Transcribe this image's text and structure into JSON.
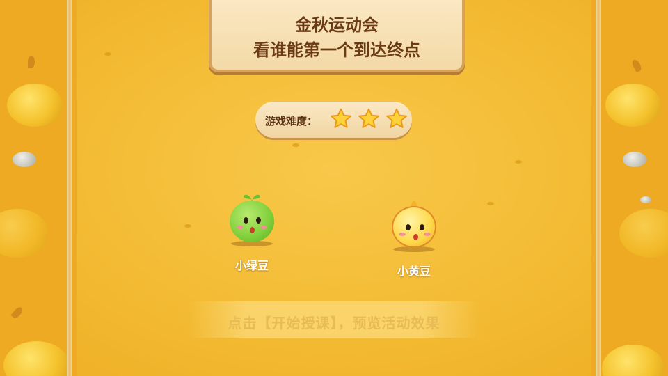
{
  "sign": {
    "line1": "金秋运动会",
    "line2": "看谁能第一个到达终点"
  },
  "difficulty": {
    "label": "游戏难度：",
    "stars": 3,
    "max_stars": 3
  },
  "characters": [
    {
      "name": "小绿豆",
      "color": "#7fcf3a"
    },
    {
      "name": "小黄豆",
      "color": "#ffd84a"
    }
  ],
  "hint": "点击【开始授课】，预览活动效果",
  "colors": {
    "background": "#f3bb33",
    "sign_text": "#6b3b16",
    "star": "#ffd23a"
  }
}
